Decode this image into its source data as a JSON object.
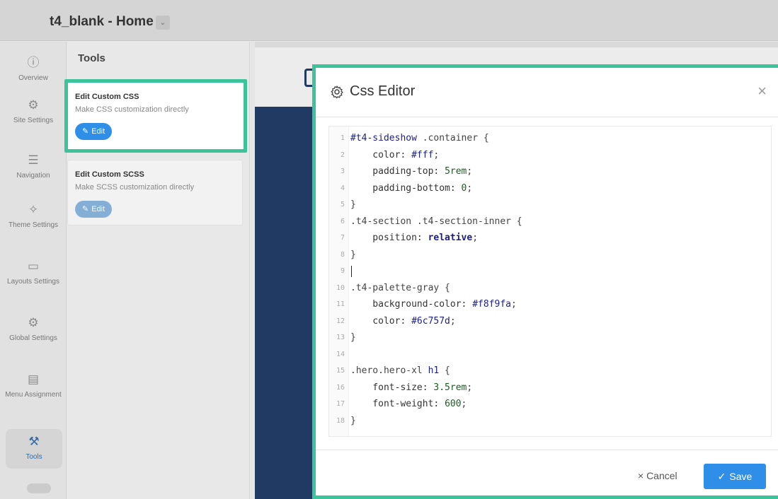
{
  "header": {
    "title": "t4_blank - Home",
    "dropdown_icon": "chevron-down-icon"
  },
  "nav": {
    "items": [
      {
        "label": "Overview",
        "icon": "info-icon",
        "glyph": "ⓘ"
      },
      {
        "label": "Site Settings",
        "icon": "gears-icon",
        "glyph": "⚙"
      },
      {
        "label": "Navigation",
        "icon": "menu-icon",
        "glyph": "☰"
      },
      {
        "label": "Theme Settings",
        "icon": "magic-wand-icon",
        "glyph": "✧"
      },
      {
        "label": "Layouts Settings",
        "icon": "layout-icon",
        "glyph": "▭"
      },
      {
        "label": "Global Settings",
        "icon": "gears-icon",
        "glyph": "⚙"
      },
      {
        "label": "Menu Assignment",
        "icon": "list-icon",
        "glyph": "▤"
      },
      {
        "label": "Tools",
        "icon": "tools-icon",
        "glyph": "⚒"
      }
    ],
    "active": "Tools"
  },
  "tools": {
    "heading": "Tools",
    "cards": [
      {
        "title": "Edit Custom CSS",
        "description": "Make CSS customization directly",
        "button": "Edit"
      },
      {
        "title": "Edit Custom SCSS",
        "description": "Make SCSS customization directly",
        "button": "Edit"
      }
    ]
  },
  "modal": {
    "title": "Css Editor",
    "close": "×",
    "lines": [
      {
        "n": "1",
        "parts": [
          [
            "sel",
            "#t4-sideshow"
          ],
          [
            "plain",
            " .container {"
          ]
        ]
      },
      {
        "n": "2",
        "parts": [
          [
            "prop",
            "    color: "
          ],
          [
            "sel",
            "#fff"
          ],
          [
            "plain",
            ";"
          ]
        ]
      },
      {
        "n": "3",
        "parts": [
          [
            "prop",
            "    padding-top: "
          ],
          [
            "val",
            "5rem"
          ],
          [
            "plain",
            ";"
          ]
        ]
      },
      {
        "n": "4",
        "parts": [
          [
            "prop",
            "    padding-bottom: "
          ],
          [
            "val",
            "0"
          ],
          [
            "plain",
            ";"
          ]
        ]
      },
      {
        "n": "5",
        "parts": [
          [
            "plain",
            "}"
          ]
        ]
      },
      {
        "n": "6",
        "parts": [
          [
            "plain",
            ".t4-section .t4-section-inner {"
          ]
        ]
      },
      {
        "n": "7",
        "parts": [
          [
            "prop",
            "    position: "
          ],
          [
            "kw",
            "relative"
          ],
          [
            "plain",
            ";"
          ]
        ]
      },
      {
        "n": "8",
        "parts": [
          [
            "plain",
            "}"
          ]
        ]
      },
      {
        "n": "9",
        "parts": []
      },
      {
        "n": "10",
        "parts": [
          [
            "plain",
            ".t4-palette-gray {"
          ]
        ]
      },
      {
        "n": "11",
        "parts": [
          [
            "prop",
            "    background-color: "
          ],
          [
            "sel",
            "#f8f9fa"
          ],
          [
            "plain",
            ";"
          ]
        ]
      },
      {
        "n": "12",
        "parts": [
          [
            "prop",
            "    color: "
          ],
          [
            "sel",
            "#6c757d"
          ],
          [
            "plain",
            ";"
          ]
        ]
      },
      {
        "n": "13",
        "parts": [
          [
            "plain",
            "}"
          ]
        ]
      },
      {
        "n": "14",
        "parts": []
      },
      {
        "n": "15",
        "parts": [
          [
            "plain",
            ".hero.hero-xl "
          ],
          [
            "sel",
            "h1"
          ],
          [
            "plain",
            " {"
          ]
        ]
      },
      {
        "n": "16",
        "parts": [
          [
            "prop",
            "    font-size: "
          ],
          [
            "val",
            "3.5rem"
          ],
          [
            "plain",
            ";"
          ]
        ]
      },
      {
        "n": "17",
        "parts": [
          [
            "prop",
            "    font-weight: "
          ],
          [
            "val",
            "600"
          ],
          [
            "plain",
            ";"
          ]
        ]
      },
      {
        "n": "18",
        "parts": [
          [
            "plain",
            "}"
          ]
        ]
      }
    ],
    "cancel_label": "× Cancel",
    "save_label": "Save"
  },
  "colors": {
    "accent": "#2f8fe8",
    "highlight_border": "#3cc39a",
    "preview_dark": "#203a63"
  }
}
